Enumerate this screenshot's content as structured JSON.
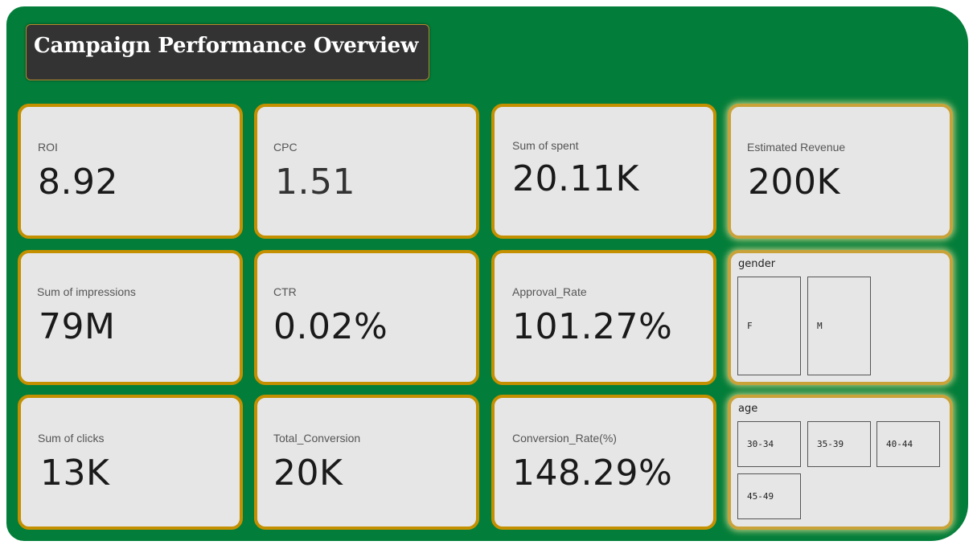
{
  "header": {
    "title": "Campaign Performance Overview"
  },
  "kpis": {
    "roi": {
      "label": "ROI",
      "value": "8.92"
    },
    "cpc": {
      "label": "CPC",
      "value": "1.51"
    },
    "spent": {
      "label": "Sum of spent",
      "value": "20.11K"
    },
    "revenue": {
      "label": "Estimated Revenue",
      "value": "200K"
    },
    "impressions": {
      "label": "Sum of impressions",
      "value": "79M"
    },
    "ctr": {
      "label": "CTR",
      "value": "0.02%"
    },
    "approval": {
      "label": "Approval_Rate",
      "value": "101.27%"
    },
    "clicks": {
      "label": "Sum of clicks",
      "value": "13K"
    },
    "conversion": {
      "label": "Total_Conversion",
      "value": "20K"
    },
    "conversion_rate": {
      "label": "Conversion_Rate(%)",
      "value": "148.29%"
    }
  },
  "slicers": {
    "gender": {
      "title": "gender",
      "options": [
        "F",
        "M"
      ]
    },
    "age": {
      "title": "age",
      "options": [
        "30-34",
        "35-39",
        "40-44",
        "45-49"
      ]
    }
  },
  "colors": {
    "background": "#037e3a",
    "card": "#e6e6e6",
    "card_border": "#c49000",
    "title_bg": "#333333"
  }
}
